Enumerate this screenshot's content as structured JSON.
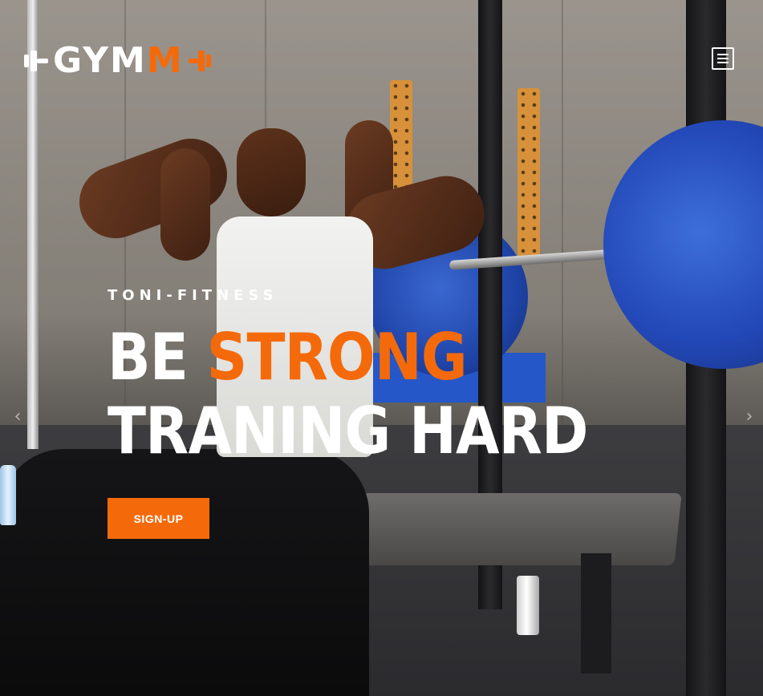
{
  "header": {
    "logo": {
      "text_main": "GYM",
      "text_accent": "M"
    },
    "menu_icon": "hamburger-menu-icon"
  },
  "hero": {
    "eyebrow": "TONI-FITNESS",
    "headline": {
      "part1": "BE ",
      "accent": "STRONG",
      "part2": " TRANING HARD"
    },
    "cta_label": "SIGN-UP",
    "prev_arrow": "‹",
    "next_arrow": "›"
  },
  "colors": {
    "accent": "#f46a0b",
    "text": "#ffffff"
  }
}
